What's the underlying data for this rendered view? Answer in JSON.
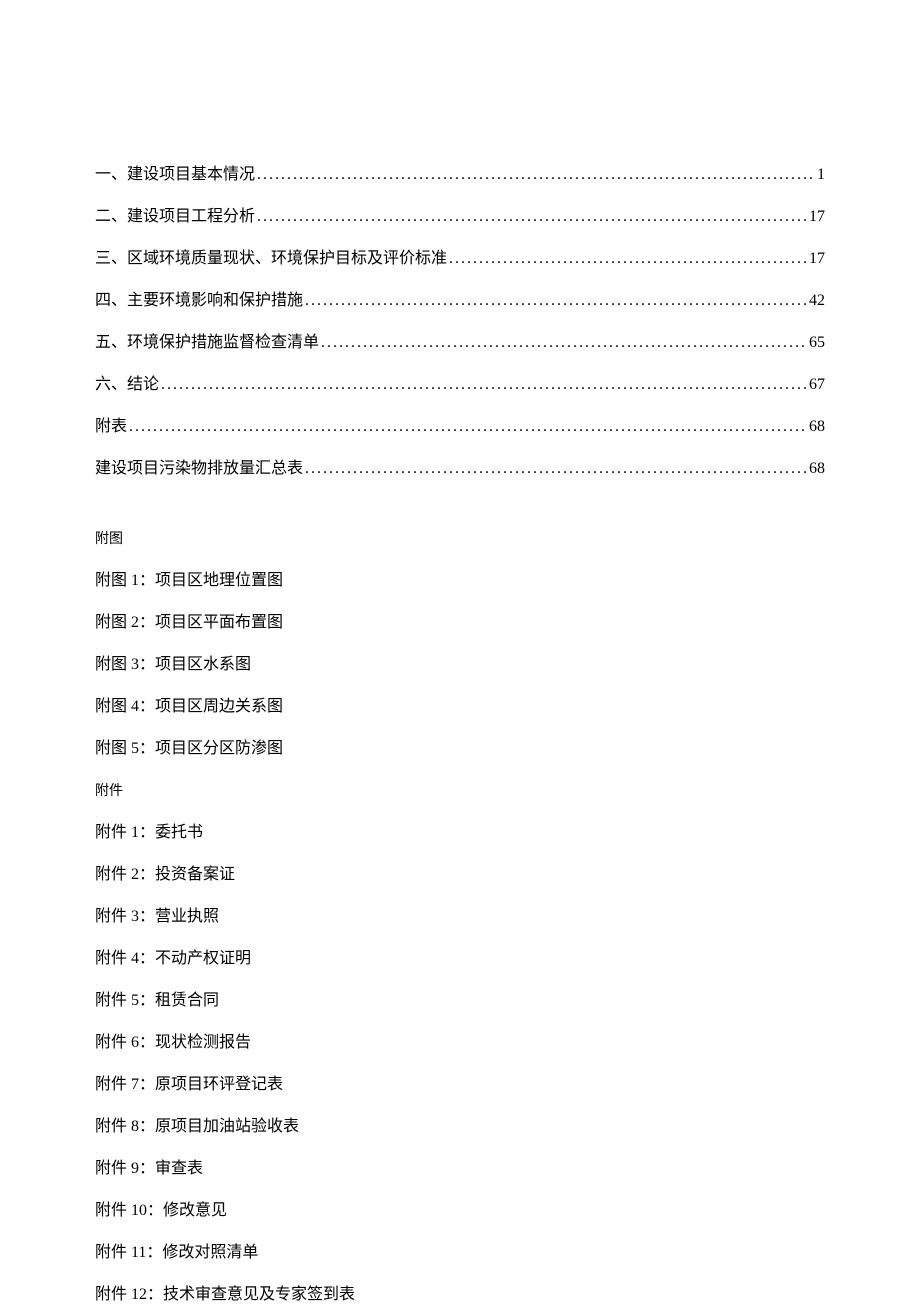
{
  "toc": [
    {
      "title": "一、建设项目基本情况",
      "page": "1"
    },
    {
      "title": "二、建设项目工程分析",
      "page": "17"
    },
    {
      "title": "三、区域环境质量现状、环境保护目标及评价标准",
      "page": "17"
    },
    {
      "title": "四、主要环境影响和保护措施",
      "page": "42"
    },
    {
      "title": "五、环境保护措施监督检查清单",
      "page": "65"
    },
    {
      "title": "六、结论",
      "page": "67"
    },
    {
      "title": "附表",
      "page": "68"
    },
    {
      "title": "建设项目污染物排放量汇总表",
      "page": "68"
    }
  ],
  "figures": {
    "header": "附图",
    "items": [
      "附图 1：项目区地理位置图",
      "附图 2：项目区平面布置图",
      "附图 3：项目区水系图",
      "附图 4：项目区周边关系图",
      "附图 5：项目区分区防渗图"
    ]
  },
  "attachments": {
    "header": "附件",
    "items": [
      "附件 1：委托书",
      "附件 2：投资备案证",
      "附件 3：营业执照",
      "附件 4：不动产权证明",
      "附件 5：租赁合同",
      "附件 6：现状检测报告",
      "附件 7：原项目环评登记表",
      "附件 8：原项目加油站验收表",
      "附件 9：审查表",
      "附件 10：修改意见",
      "附件 11：修改对照清单",
      "附件 12：技术审查意见及专家签到表"
    ]
  }
}
